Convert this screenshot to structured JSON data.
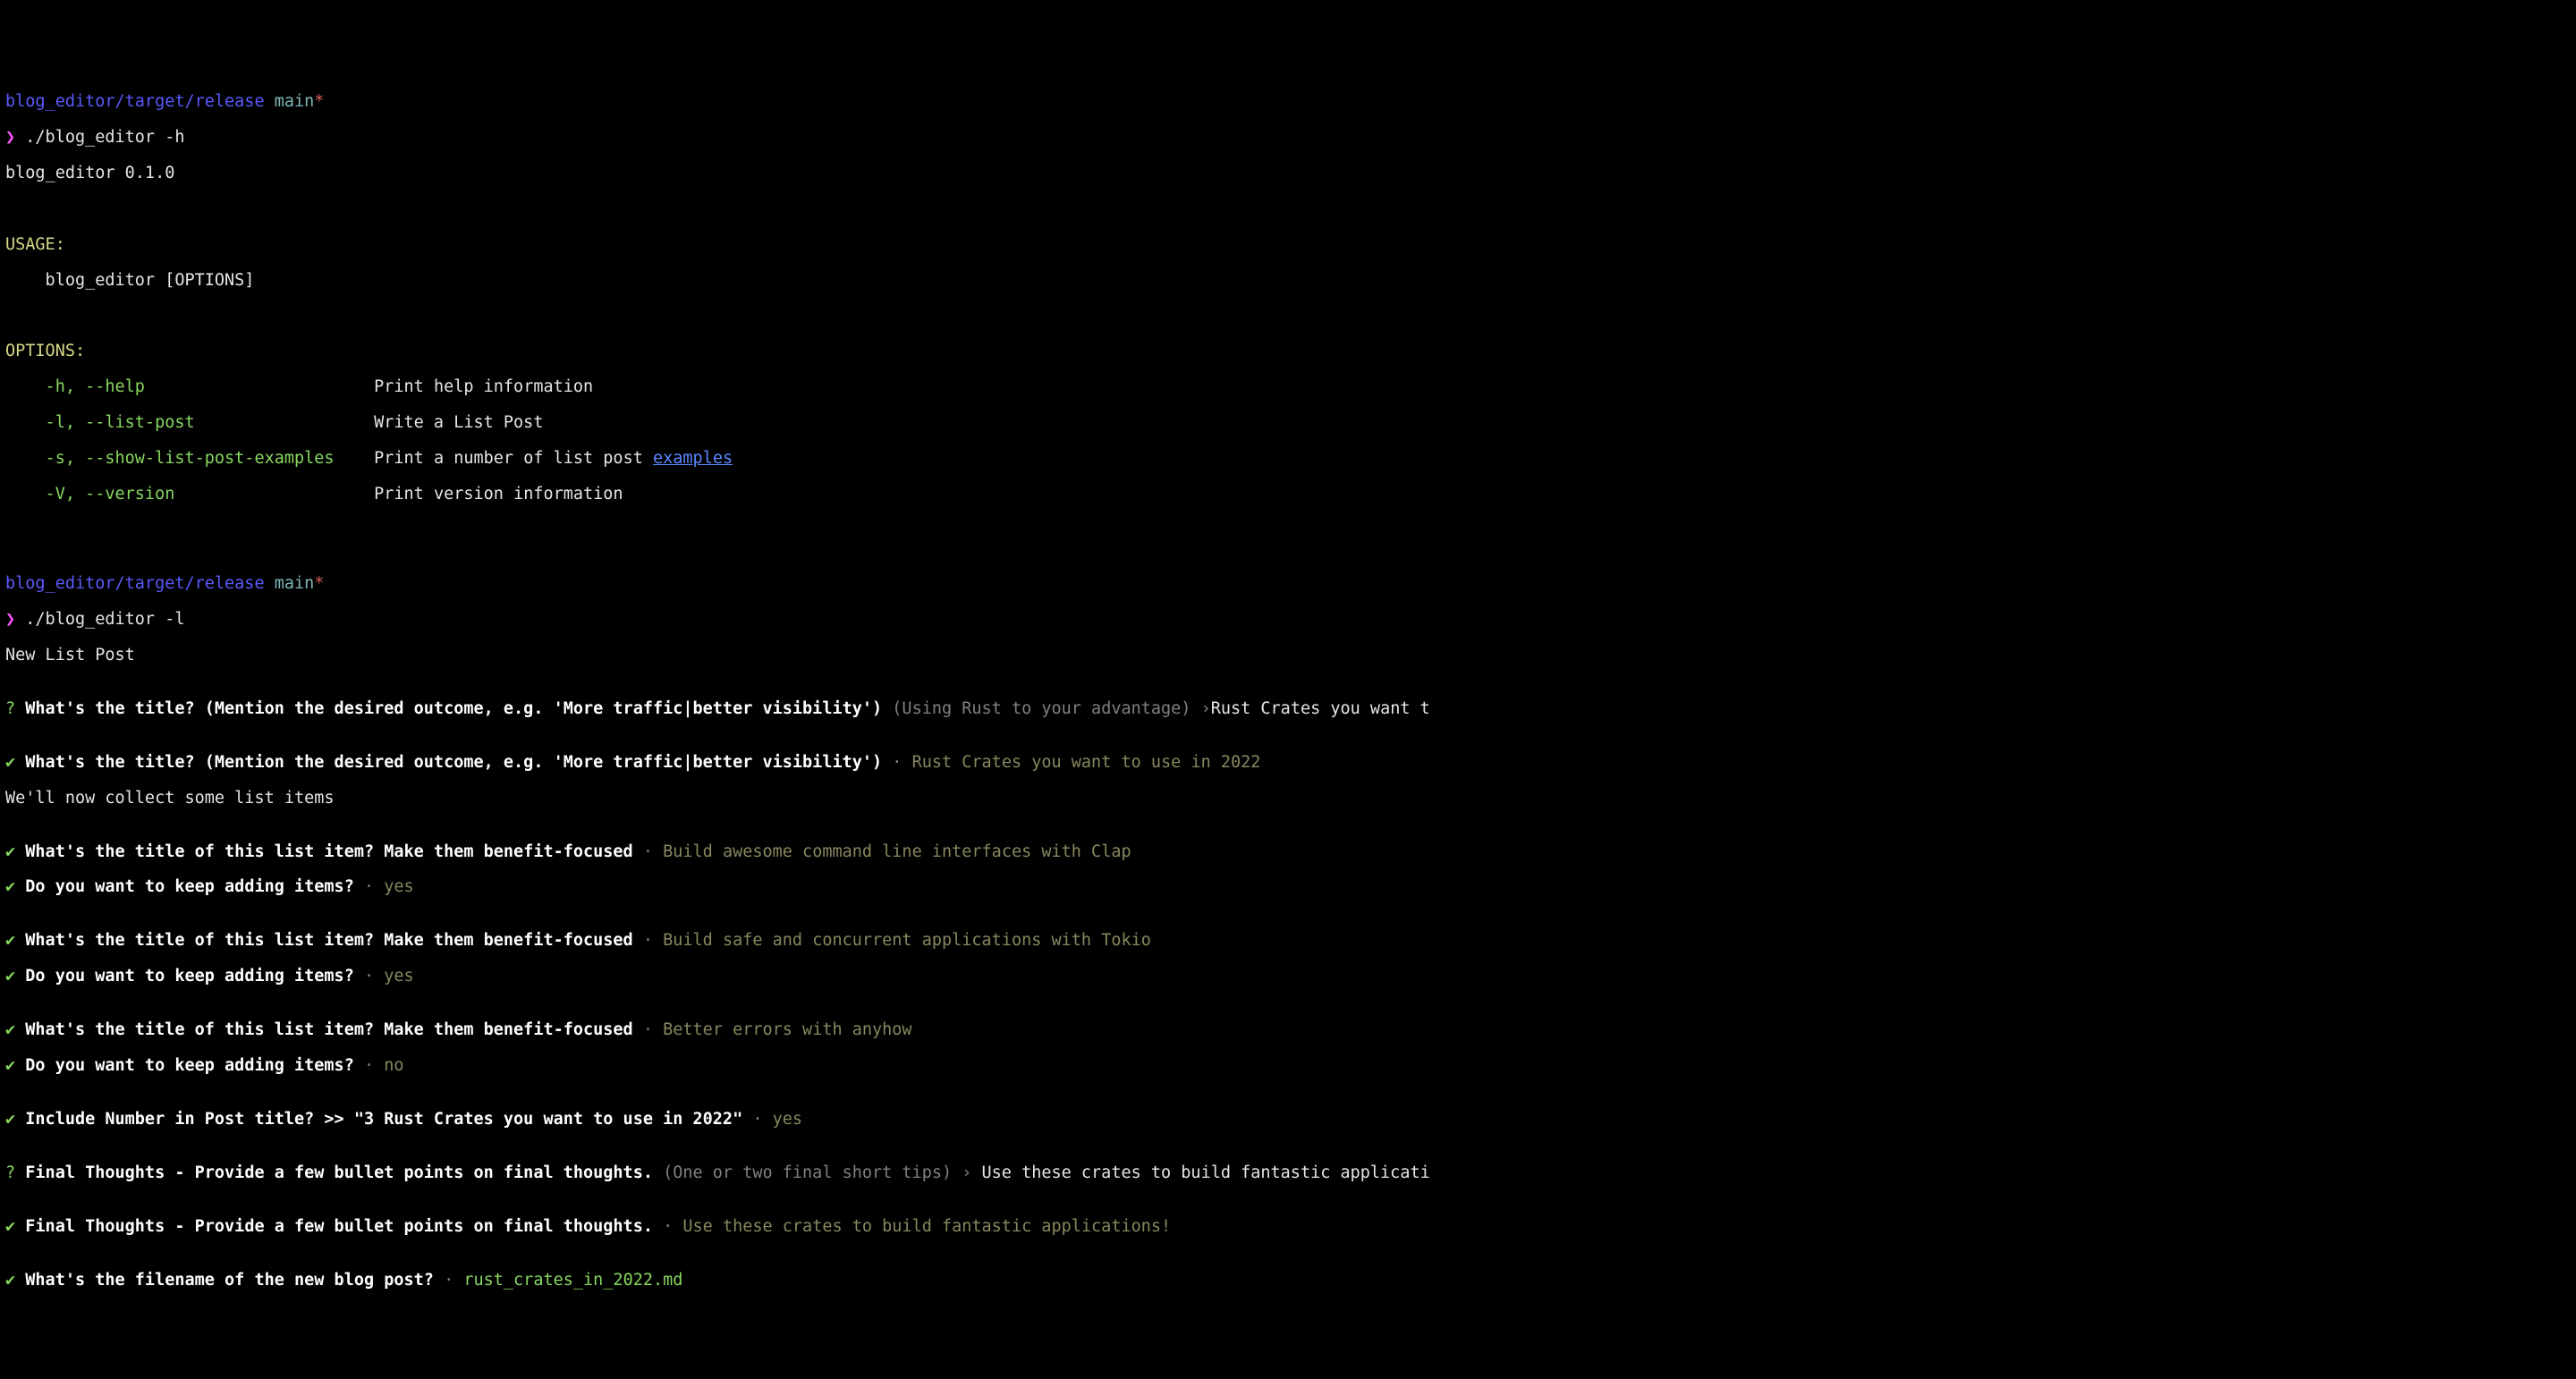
{
  "prompt1": {
    "path": "blog_editor/target/release",
    "branch": "main",
    "dirty": "*",
    "arrow": "❯",
    "cmd": "./blog_editor -h"
  },
  "help": {
    "name_version": "blog_editor 0.1.0",
    "usage_label": "USAGE:",
    "usage_line": "    blog_editor [OPTIONS]",
    "options_label": "OPTIONS:",
    "opts": [
      {
        "flag": "    -h, --help",
        "pad": "                       ",
        "desc": "Print help information"
      },
      {
        "flag": "    -l, --list-post",
        "pad": "                  ",
        "desc": "Write a List Post"
      },
      {
        "flag": "    -s, --show-list-post-examples",
        "pad": "    ",
        "desc": "Print a number of list post ",
        "link": "examples"
      },
      {
        "flag": "    -V, --version",
        "pad": "                    ",
        "desc": "Print version information"
      }
    ]
  },
  "prompt2": {
    "path": "blog_editor/target/release",
    "branch": "main",
    "dirty": "*",
    "arrow": "❯",
    "cmd": "./blog_editor -l"
  },
  "session": {
    "header": "New List Post",
    "title_prompt": {
      "mark_q": "?",
      "mark_ok": "✔",
      "q": " What's the title? (Mention the desired outcome, e.g. 'More traffic|better visibility')",
      "hint": " (Using Rust to your advantage) ",
      "caret": "›",
      "typing": "Rust Crates you want t",
      "sep": " · ",
      "answer": "Rust Crates you want to use in 2022"
    },
    "collect_label": "We'll now collect some list items",
    "item_q": " What's the title of this list item? Make them benefit-focused",
    "keep_q": " Do you want to keep adding items?",
    "sep": " · ",
    "items": [
      {
        "title": "Build awesome command line interfaces with Clap",
        "keep": "yes"
      },
      {
        "title": "Build safe and concurrent applications with Tokio",
        "keep": "yes"
      },
      {
        "title": "Better errors with anyhow",
        "keep": "no"
      }
    ],
    "include_number": {
      "q": " Include Number in Post title? >> \"3 Rust Crates you want to use in 2022\"",
      "answer": "yes"
    },
    "final_thoughts": {
      "mark_q": "?",
      "mark_ok": "✔",
      "q": " Final Thoughts - Provide a few bullet points on final thoughts.",
      "hint": " (One or two final short tips) ",
      "caret": "› ",
      "typing": "Use these crates to build fantastic applicati",
      "answer": "Use these crates to build fantastic applications!"
    },
    "filename": {
      "q": " What's the filename of the new blog post?",
      "answer": "rust_crates_in_2022.md"
    }
  }
}
